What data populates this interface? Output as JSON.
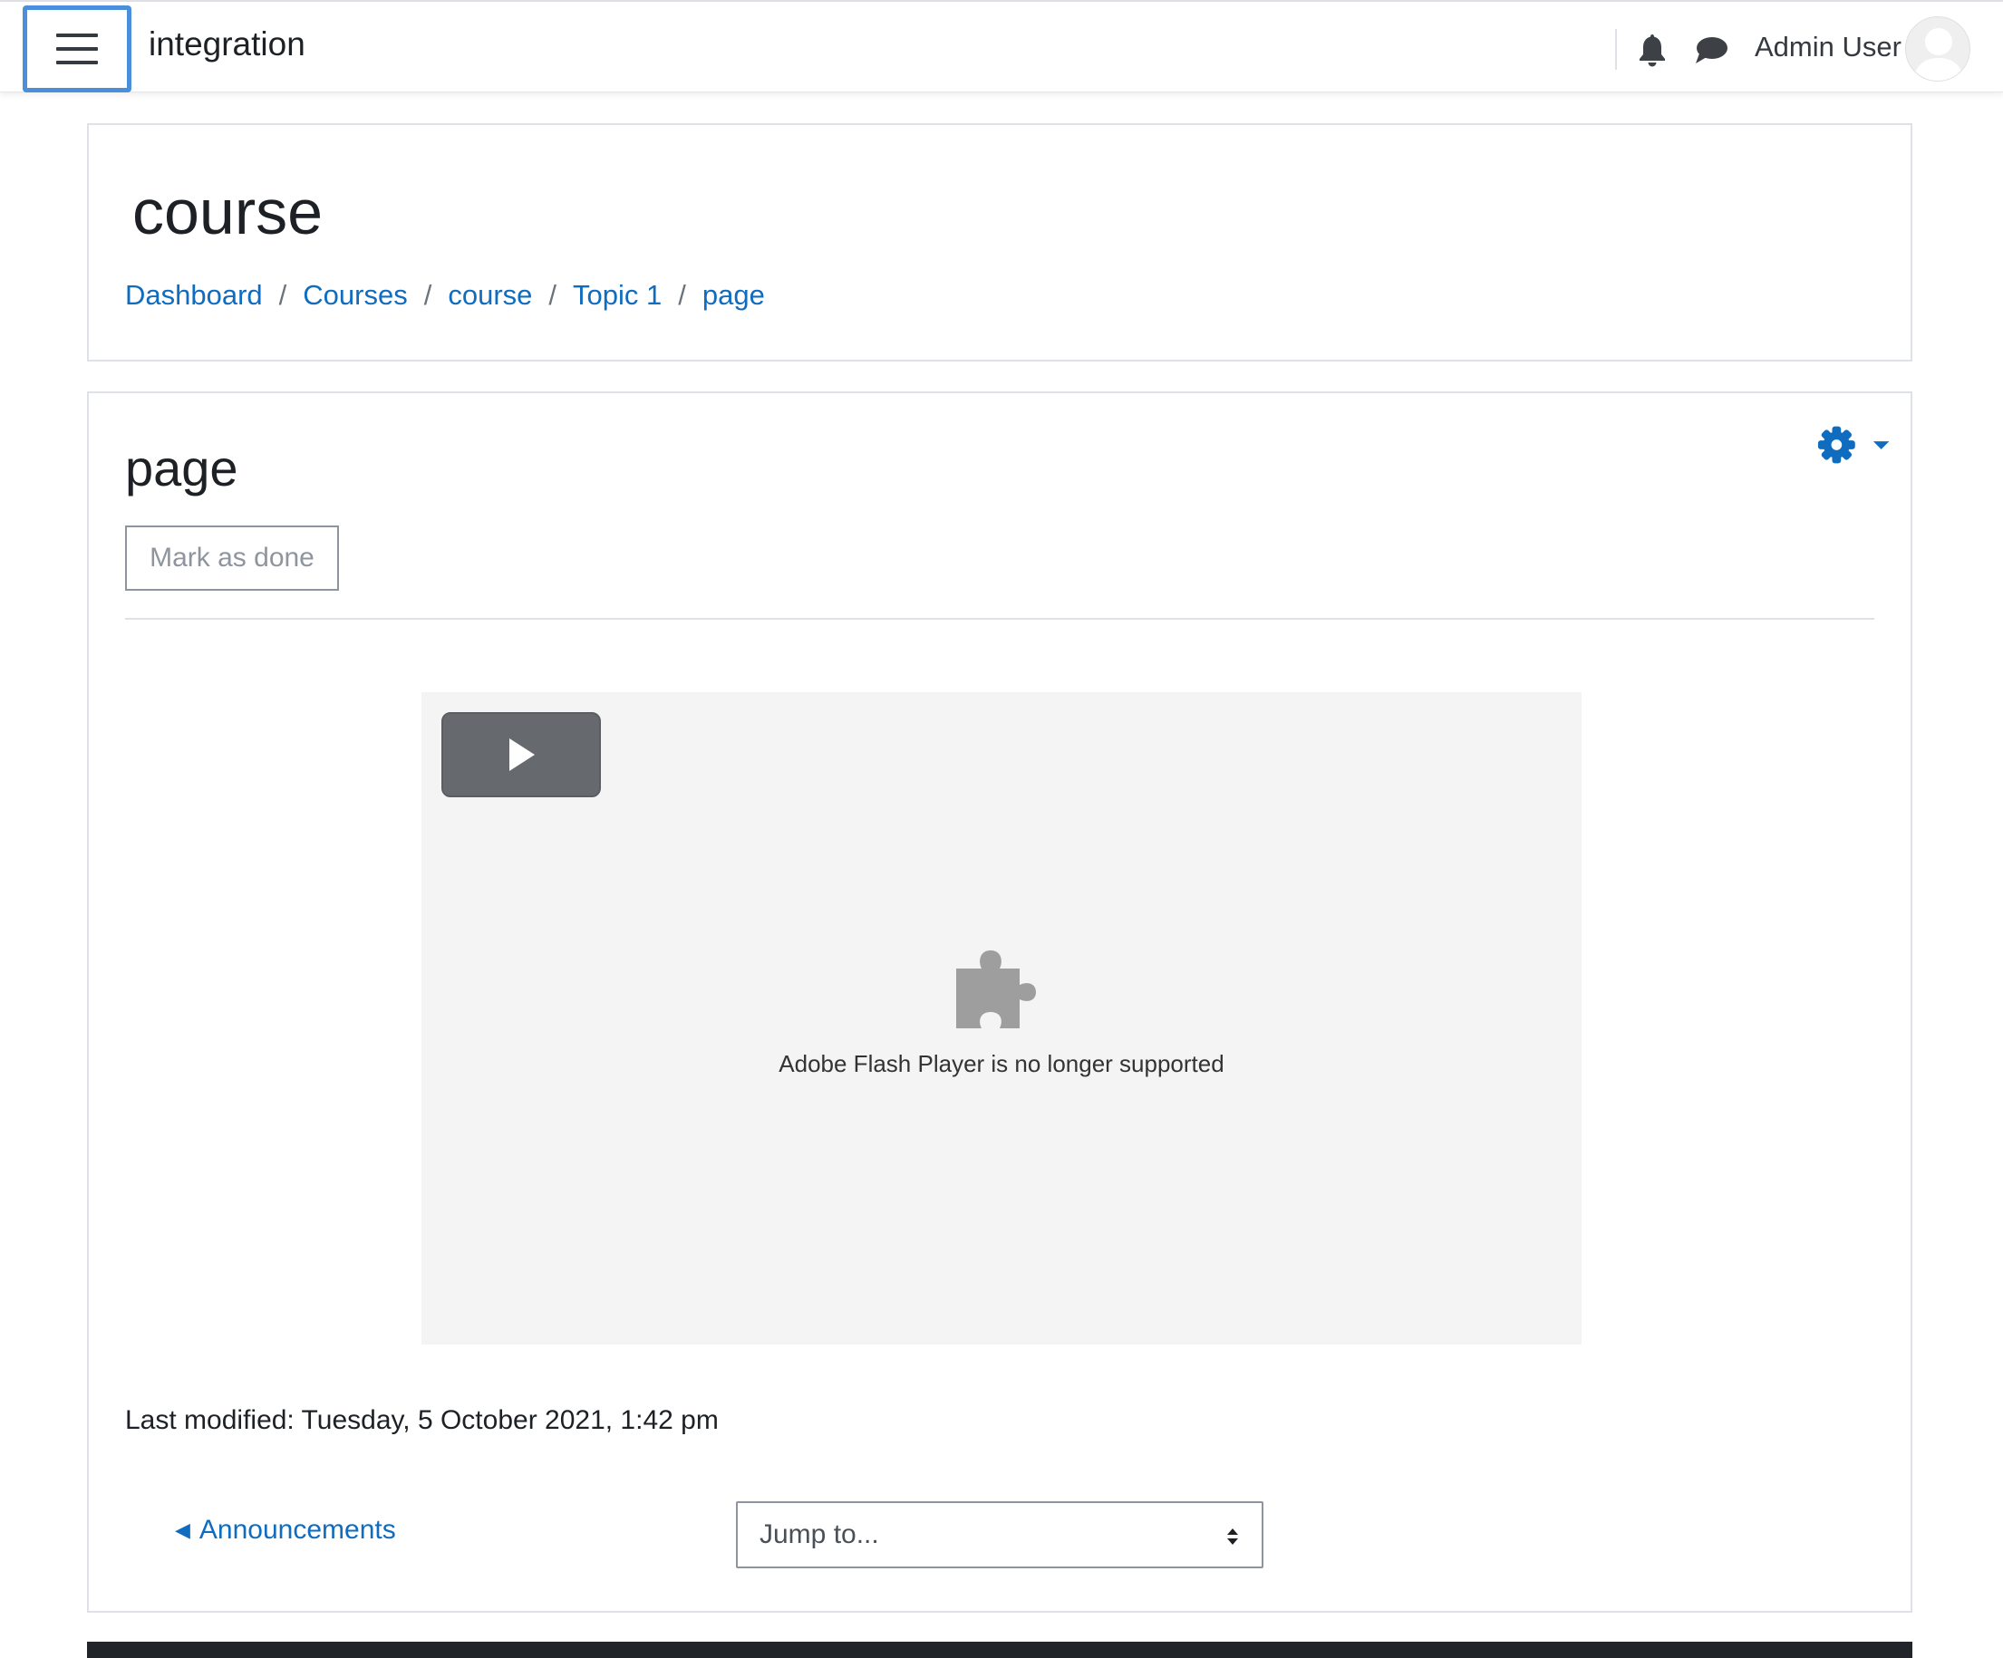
{
  "navbar": {
    "site_name": "integration",
    "user_name": "Admin User"
  },
  "header": {
    "course_title": "course",
    "breadcrumb": [
      "Dashboard",
      "Courses",
      "course",
      "Topic 1",
      "page"
    ],
    "separator": "/"
  },
  "main": {
    "page_title": "page",
    "mark_done_label": "Mark as done",
    "flash_message": "Adobe Flash Player is no longer supported",
    "last_modified": "Last modified: Tuesday, 5 October 2021, 1:42 pm",
    "prev_activity_label": "Announcements",
    "prev_activity_arrow": "◀",
    "jump_to_value": "Jump to..."
  },
  "colors": {
    "link": "#0f6cbf",
    "focus_outline": "#4a8fdc",
    "footer": "#212529"
  },
  "icons": {
    "menu": "hamburger-icon",
    "notifications": "bell-icon",
    "messages": "chat-icon",
    "settings": "gear-icon",
    "play": "play-icon",
    "plugin": "puzzle-piece-icon"
  }
}
